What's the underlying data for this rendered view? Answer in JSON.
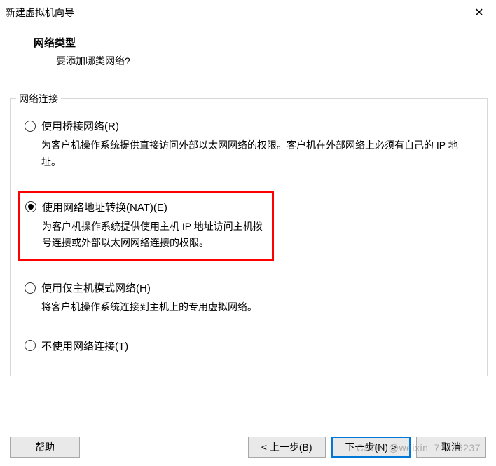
{
  "window": {
    "title": "新建虚拟机向导"
  },
  "header": {
    "title": "网络类型",
    "subtitle": "要添加哪类网络?"
  },
  "group": {
    "title": "网络连接"
  },
  "options": {
    "bridged": {
      "label": "使用桥接网络(R)",
      "desc": "为客户机操作系统提供直接访问外部以太网网络的权限。客户机在外部网络上必须有自己的 IP 地址。"
    },
    "nat": {
      "label": "使用网络地址转换(NAT)(E)",
      "desc": "为客户机操作系统提供使用主机 IP 地址访问主机拨号连接或外部以太网网络连接的权限。"
    },
    "hostonly": {
      "label": "使用仅主机模式网络(H)",
      "desc": "将客户机操作系统连接到主机上的专用虚拟网络。"
    },
    "none": {
      "label": "不使用网络连接(T)"
    }
  },
  "buttons": {
    "help": "帮助",
    "back": "< 上一步(B)",
    "next": "下一步(N) >",
    "cancel": "取消"
  },
  "watermark": "CSDN @weixin_71436237"
}
